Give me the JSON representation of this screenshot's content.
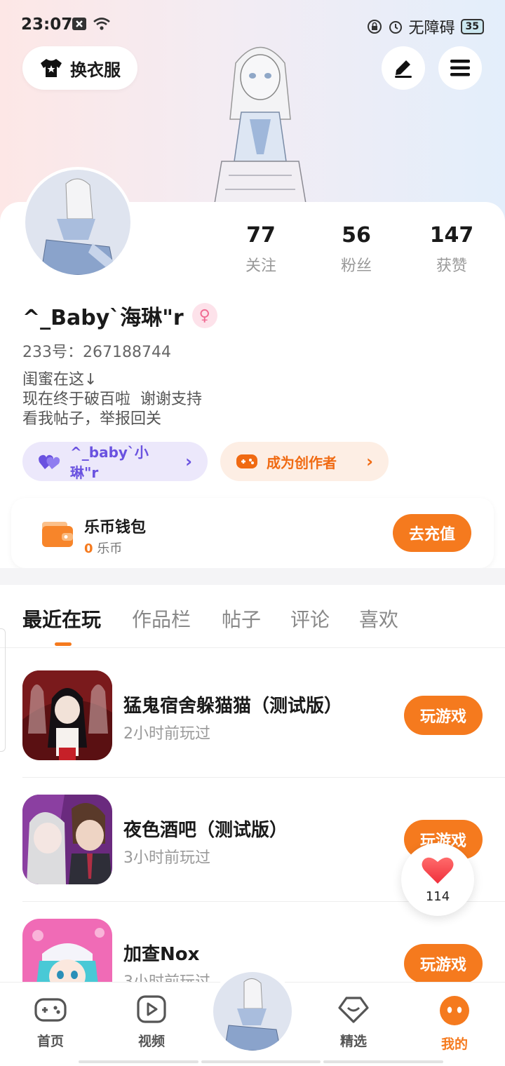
{
  "status_bar": {
    "time": "23:07",
    "accessibility": "无障碍",
    "battery": "35",
    "icons": [
      "close-box-icon",
      "wifi-icon",
      "lock-rotation-icon",
      "alarm-icon"
    ]
  },
  "header": {
    "outfit_button": "换衣服",
    "edit_icon": "pen-icon",
    "menu_icon": "menu-icon"
  },
  "profile": {
    "stats": [
      {
        "value": "77",
        "label": "关注"
      },
      {
        "value": "56",
        "label": "粉丝"
      },
      {
        "value": "147",
        "label": "获赞"
      }
    ],
    "username": "^_Baby`海琳\"r",
    "gender_icon": "female-icon",
    "uid": "233号：267188744",
    "bio": [
      "闺蜜在这↓",
      "现在终于破百啦  谢谢支持",
      "看我帖子，举报回关"
    ],
    "friend_chip": "^_baby`小琳\"r",
    "creator_chip": "成为创作者"
  },
  "wallet": {
    "title": "乐币钱包",
    "balance": "0",
    "unit": "乐币",
    "recharge": "去充值"
  },
  "tabs": [
    "最近在玩",
    "作品栏",
    "帖子",
    "评论",
    "喜欢"
  ],
  "games": [
    {
      "title": "猛鬼宿舍躲猫猫（测试版）",
      "time": "2小时前玩过",
      "button": "玩游戏"
    },
    {
      "title": "夜色酒吧（测试版）",
      "time": "3小时前玩过",
      "button": "玩游戏"
    },
    {
      "title": "加查Nox",
      "time": "3小时前玩过",
      "button": "玩游戏"
    }
  ],
  "like_float": {
    "count": "114"
  },
  "bottom_nav": [
    {
      "label": "首页",
      "icon": "gamepad-icon"
    },
    {
      "label": "视频",
      "icon": "play-icon"
    },
    {
      "label": "精选",
      "icon": "heart-diamond-icon"
    },
    {
      "label": "我的",
      "icon": "face-icon"
    }
  ],
  "colors": {
    "accent": "#f57a1e",
    "purple": "#6a52e0"
  }
}
